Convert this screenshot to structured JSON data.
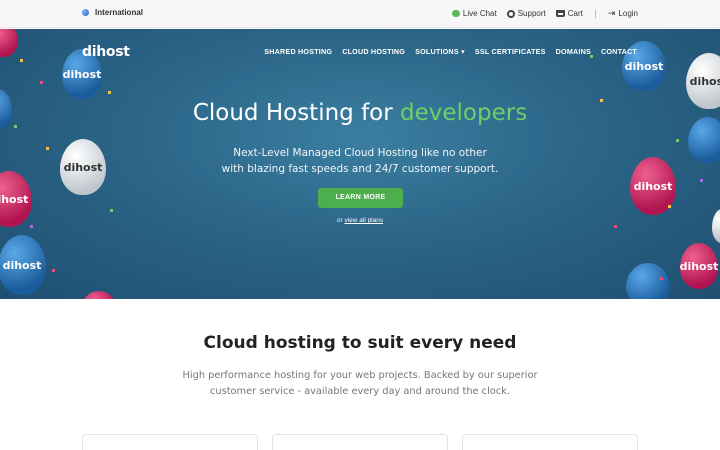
{
  "topbar": {
    "region": "International",
    "links": [
      {
        "label": "Live Chat",
        "icon": "chat-icon"
      },
      {
        "label": "Support",
        "icon": "support-icon"
      },
      {
        "label": "Cart",
        "icon": "cart-icon"
      },
      {
        "label": "Login",
        "icon": "login-icon"
      }
    ]
  },
  "header": {
    "logo": "dihost",
    "nav": [
      "SHARED HOSTING",
      "CLOUD HOSTING",
      "SOLUTIONS ▾",
      "SSL CERTIFICATES",
      "DOMAINS",
      "CONTACT"
    ]
  },
  "hero": {
    "headline_prefix": "Cloud Hosting for ",
    "headline_highlight": "developers",
    "subtitle_line1": "Next-Level Managed Cloud Hosting like no other",
    "subtitle_line2": "with blazing fast speeds and 24/7 customer support.",
    "cta_label": "LEARN MORE",
    "plans_prefix": "or ",
    "plans_link": "view all plans",
    "balloon_text": "dihost"
  },
  "section": {
    "title": "Cloud hosting to suit every need",
    "body_line1": "High performance hosting for your web projects. Backed by our superior",
    "body_line2": "customer service - available every day and around the clock."
  },
  "colors": {
    "accent_green": "#4cae4c",
    "highlight_green": "#6ed067",
    "hero_blue": "#2b6588"
  }
}
